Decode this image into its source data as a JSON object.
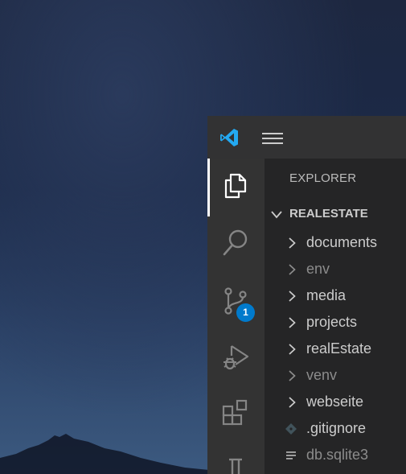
{
  "titlebar": {
    "logo_icon": "vscode-logo-icon",
    "menu_icon": "hamburger-menu-icon"
  },
  "activity_bar": {
    "items": [
      {
        "name": "explorer",
        "icon": "files-icon",
        "active": true
      },
      {
        "name": "search",
        "icon": "search-icon"
      },
      {
        "name": "source-control",
        "icon": "source-control-icon",
        "badge": "1"
      },
      {
        "name": "run-debug",
        "icon": "run-debug-icon"
      },
      {
        "name": "extensions",
        "icon": "extensions-icon"
      },
      {
        "name": "testing",
        "icon": "beaker-icon"
      }
    ]
  },
  "sidebar": {
    "title": "EXPLORER",
    "section": {
      "name": "REALESTATE",
      "expanded": true
    },
    "items": [
      {
        "label": "documents",
        "type": "folder",
        "dim": false
      },
      {
        "label": "env",
        "type": "folder",
        "dim": true
      },
      {
        "label": "media",
        "type": "folder",
        "dim": false
      },
      {
        "label": "projects",
        "type": "folder",
        "dim": false
      },
      {
        "label": "realEstate",
        "type": "folder",
        "dim": false
      },
      {
        "label": "venv",
        "type": "folder",
        "dim": true
      },
      {
        "label": "webseite",
        "type": "folder",
        "dim": false
      },
      {
        "label": ".gitignore",
        "type": "file",
        "icon": "git-file-icon",
        "dim": false
      },
      {
        "label": "db.sqlite3",
        "type": "file",
        "icon": "text-lines-icon",
        "dim": true
      }
    ]
  },
  "colors": {
    "accent": "#007acc",
    "logo": "#23a9f2",
    "titlebar": "#323233",
    "activitybar": "#333333",
    "sidebar": "#252526"
  }
}
